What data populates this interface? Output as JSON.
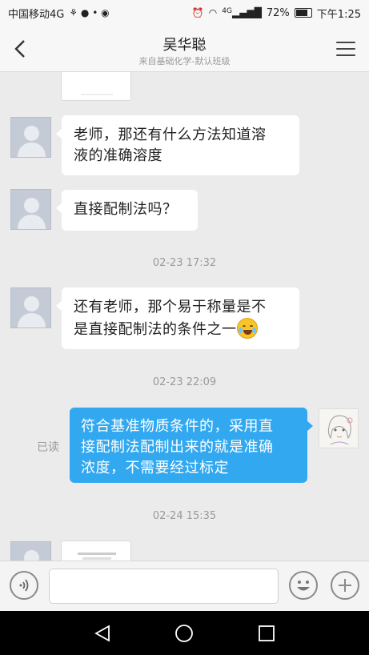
{
  "status_bar": {
    "carrier": "中国移动4G",
    "signal_label": "4G",
    "battery": "72%",
    "time": "下午1:25"
  },
  "header": {
    "title": "吴华聪",
    "subtitle": "来自基础化学-默认班级"
  },
  "messages": [
    {
      "side": "left",
      "text_lines": [
        "老师，那还有什么方法知道溶",
        "液的准确溶度"
      ]
    },
    {
      "side": "left",
      "text_lines": [
        "直接配制法吗？"
      ]
    },
    {
      "timestamp": "02-23 17:32"
    },
    {
      "side": "left",
      "text_lines": [
        "还有老师，那个易于称量是不",
        "是直接配制法的条件之一"
      ],
      "emoji": "laughing-tears"
    },
    {
      "timestamp": "02-23 22:09"
    },
    {
      "side": "right",
      "read_label": "已读",
      "text_lines": [
        "符合基准物质条件的，采用直",
        "接配制法配制出来的就是准确",
        "浓度，不需要经过标定"
      ]
    },
    {
      "timestamp": "02-24 15:35"
    }
  ],
  "input_bar": {
    "placeholder": ""
  },
  "colors": {
    "chat_bg": "#ebebeb",
    "my_bubble": "#32a8f0",
    "other_bubble": "#ffffff"
  }
}
